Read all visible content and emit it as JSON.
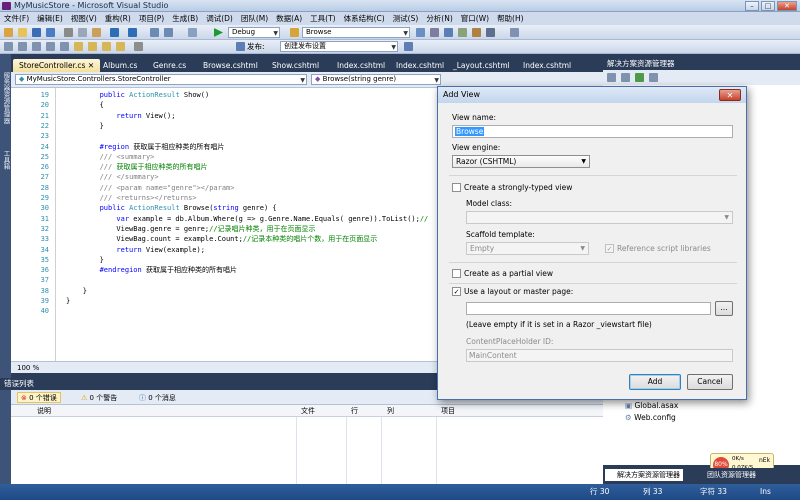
{
  "window": {
    "title": "MyMusicStore - Microsoft Visual Studio",
    "minimize": "–",
    "maximize": "□",
    "close": "✕"
  },
  "menu": [
    "文件(F)",
    "编辑(E)",
    "视图(V)",
    "重构(R)",
    "项目(P)",
    "生成(B)",
    "调试(D)",
    "团队(M)",
    "数据(A)",
    "工具(T)",
    "体系结构(C)",
    "测试(S)",
    "分析(N)",
    "窗口(W)",
    "帮助(H)"
  ],
  "toolbar": {
    "config": "Debug",
    "find": "Browse",
    "publish_label": "发布:",
    "publish_value": "创建发布设置"
  },
  "left_strip": [
    "服务器资源管理器",
    "工具箱"
  ],
  "tabs": [
    "StoreController.cs",
    "Album.cs",
    "Genre.cs",
    "Browse.cshtml",
    "Show.cshtml",
    "Index.cshtml",
    "Index.cshtml",
    "_Layout.cshtml",
    "Index.cshtml"
  ],
  "nav": {
    "class": "MyMusicStore.Controllers.StoreController",
    "member": "Browse(string genre)"
  },
  "code_lines": [
    {
      "n": "19",
      "t": "public ActionResult Show()"
    },
    {
      "n": "20",
      "t": "{"
    },
    {
      "n": "21",
      "t": "return View();"
    },
    {
      "n": "22",
      "t": "}"
    },
    {
      "n": "23",
      "t": ""
    },
    {
      "n": "24",
      "t": "#region 获取属于相应种类的所有唱片"
    },
    {
      "n": "25",
      "t": "/// <summary>"
    },
    {
      "n": "26",
      "t": "/// 获取属于相应种类的所有唱片"
    },
    {
      "n": "27",
      "t": "/// </summary>"
    },
    {
      "n": "28",
      "t": "/// <param name=\"genre\"></param>"
    },
    {
      "n": "29",
      "t": "/// <returns></returns>"
    },
    {
      "n": "30",
      "t": "public ActionResult Browse(string genre) {"
    },
    {
      "n": "31",
      "t": "var example = db.Album.Where(g => g.Genre.Name.Equals( genre)).ToList();//"
    },
    {
      "n": "32",
      "t": "ViewBag.genre = genre;//记录唱片种类，用于在页面显示"
    },
    {
      "n": "33",
      "t": "ViewBag.count = example.Count;//记录本种类的唱片个数，用于在页面显示"
    },
    {
      "n": "34",
      "t": "return View(example);"
    },
    {
      "n": "35",
      "t": "}"
    },
    {
      "n": "36",
      "t": "#endregion 获取属于相应种类的所有唱片"
    },
    {
      "n": "37",
      "t": ""
    },
    {
      "n": "38",
      "t": "}"
    },
    {
      "n": "39",
      "t": "}"
    },
    {
      "n": "40",
      "t": ""
    }
  ],
  "zoom": "100 %",
  "error_list": {
    "title": "错误列表",
    "errors": "0 个错误",
    "warnings": "0 个警告",
    "messages": "0 个消息",
    "columns": [
      "说明",
      "文件",
      "行",
      "列",
      "项目"
    ]
  },
  "solution": {
    "title": "解决方案资源管理器",
    "items": [
      "Global.asax",
      "Web.config"
    ],
    "tab_solution": "解决方案资源管理器",
    "tab_team": "团队资源管理器"
  },
  "net_monitor": {
    "percent": "80%",
    "up": "0K/s",
    "down": "0.07K/S",
    "badge": "nEk"
  },
  "status": {
    "row": "行 30",
    "col": "列 33",
    "char": "字符 33",
    "mode": "Ins"
  },
  "dialog": {
    "title": "Add View",
    "close": "✕",
    "view_name_label": "View name:",
    "view_name_value": "Browse",
    "view_engine_label": "View engine:",
    "view_engine_value": "Razor (CSHTML)",
    "strongly_typed_label": "Create a strongly-typed view",
    "model_class_label": "Model class:",
    "model_class_value": "",
    "scaffold_label": "Scaffold template:",
    "scaffold_value": "Empty",
    "reference_scripts_label": "Reference script libraries",
    "partial_label": "Create as a partial view",
    "layout_label": "Use a layout or master page:",
    "layout_value": "",
    "browse_btn": "...",
    "layout_hint": "(Leave empty if it is set in a Razor _viewstart file)",
    "placeholder_label": "ContentPlaceHolder ID:",
    "placeholder_value": "MainContent",
    "add": "Add",
    "cancel": "Cancel"
  }
}
